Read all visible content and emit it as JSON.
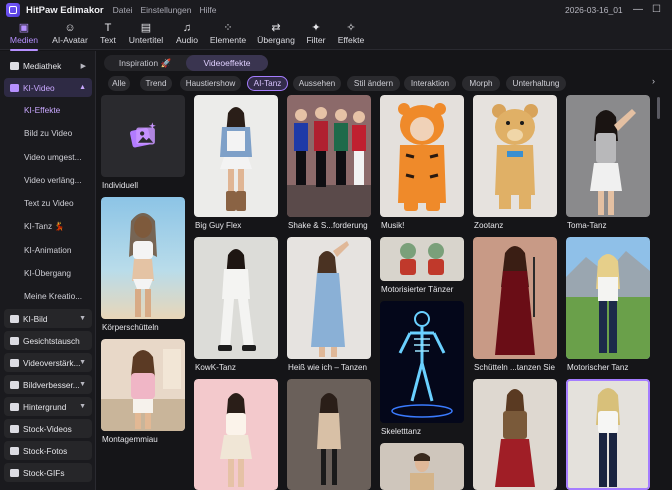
{
  "titlebar": {
    "app_name": "HitPaw Edimakor",
    "menu": [
      "Datei",
      "Einstellungen",
      "Hilfe"
    ],
    "date": "2026-03-16_01"
  },
  "toolbar": {
    "items": [
      {
        "label": "Medien",
        "icon": "media-icon",
        "active": true
      },
      {
        "label": "AI-Avatar",
        "icon": "avatar-icon"
      },
      {
        "label": "Text",
        "icon": "text-icon"
      },
      {
        "label": "Untertitel",
        "icon": "subtitle-icon"
      },
      {
        "label": "Audio",
        "icon": "audio-icon"
      },
      {
        "label": "Elemente",
        "icon": "elements-icon"
      },
      {
        "label": "Übergang",
        "icon": "transition-icon"
      },
      {
        "label": "Filter",
        "icon": "filter-icon"
      },
      {
        "label": "Effekte",
        "icon": "effects-icon"
      }
    ]
  },
  "sidebar": {
    "top": [
      {
        "label": "Mediathek",
        "icon": "folder-icon"
      },
      {
        "label": "KI-Video",
        "icon": "ai-video-icon",
        "active": true
      }
    ],
    "sub": [
      "KI-Effekte",
      "Bild zu Video",
      "Video umgest...",
      "Video verläng...",
      "Text zu Video",
      "KI-Tanz 💃",
      "KI-Animation",
      "KI-Übergang",
      "Meine Kreatio..."
    ],
    "groups": [
      {
        "label": "KI-Bild",
        "icon": "ai-image-icon"
      },
      {
        "label": "Gesichtstausch",
        "icon": "face-swap-icon"
      },
      {
        "label": "Videoverstärk...",
        "icon": "video-enhance-icon"
      },
      {
        "label": "Bildverbesser...",
        "icon": "image-enhance-icon"
      },
      {
        "label": "Hintergrund",
        "icon": "background-icon"
      },
      {
        "label": "Stock-Videos",
        "icon": "stock-video-icon"
      },
      {
        "label": "Stock-Fotos",
        "icon": "stock-photo-icon"
      },
      {
        "label": "Stock-GIFs",
        "icon": "stock-gif-icon"
      }
    ]
  },
  "tabs": {
    "inspiration": "Inspiration 🚀",
    "videoeffekte": "Videoeffekte"
  },
  "filters": [
    "Alle",
    "Trend",
    "Haustiershow",
    "AI-Tanz",
    "Aussehen",
    "Stil ändern",
    "Interaktion",
    "Morph",
    "Unterhaltung"
  ],
  "filter_active": "AI-Tanz",
  "cards": [
    {
      "label": "Individuell"
    },
    {
      "label": "Big Guy Flex"
    },
    {
      "label": "Shake & S...forderung"
    },
    {
      "label": "Musik!"
    },
    {
      "label": "Zootanz"
    },
    {
      "label": "Toma-Tanz"
    },
    {
      "label": "Körperschütteln"
    },
    {
      "label": "KowK-Tanz"
    },
    {
      "label": "Heiß wie ich – Tanzen"
    },
    {
      "label": "Motorisierter Tänzer"
    },
    {
      "label": "Schütteln ...tanzen Sie"
    },
    {
      "label": "Motorischer Tanz"
    },
    {
      "label": "Skeletttanz"
    },
    {
      "label": "Montagemmiau"
    }
  ]
}
